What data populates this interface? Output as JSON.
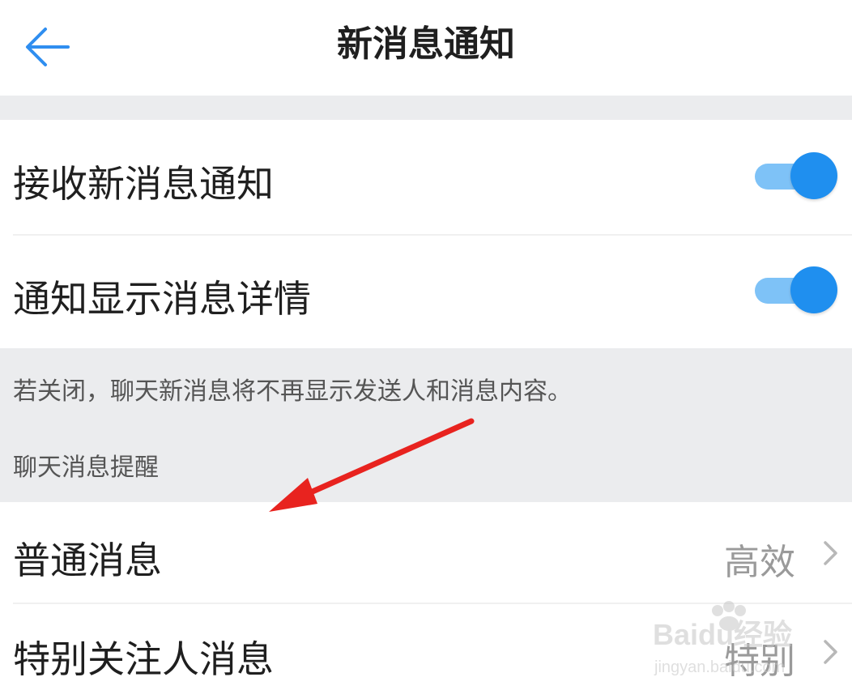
{
  "header": {
    "title": "新消息通知"
  },
  "settings": {
    "receive_label": "接收新消息通知",
    "receive_on": true,
    "detail_label": "通知显示消息详情",
    "detail_on": true
  },
  "hint_text": "若关闭，聊天新消息将不再显示发送人和消息内容。",
  "section_title": "聊天消息提醒",
  "items": [
    {
      "label": "普通消息",
      "value": "高效"
    },
    {
      "label": "特别关注人消息",
      "value": "特别"
    }
  ],
  "watermark": {
    "brand": "Baidu经验",
    "url": "jingyan.baidu.com"
  },
  "colors": {
    "accent": "#1f8fef",
    "track": "#7ec2f7",
    "section_bg": "#ebecee",
    "annotation": "#e8231f"
  }
}
